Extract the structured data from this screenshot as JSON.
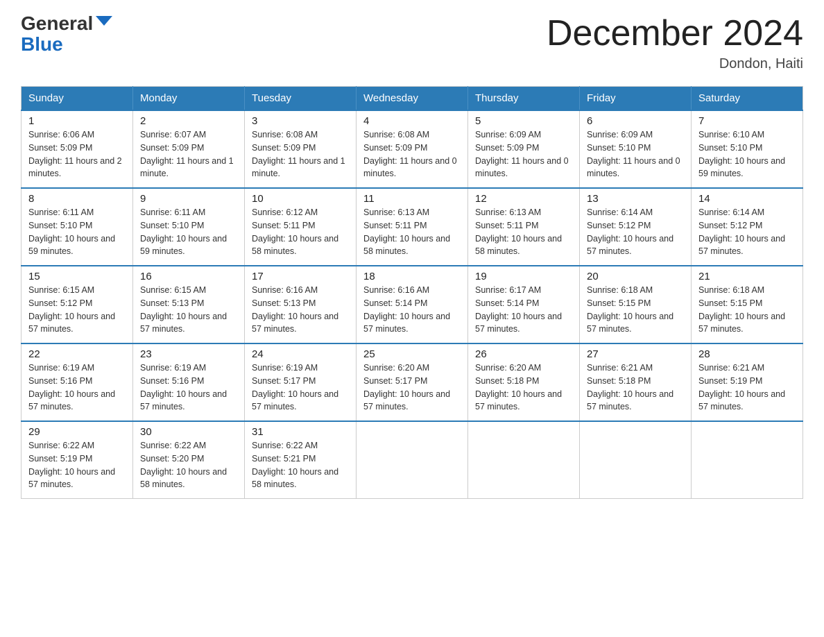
{
  "logo": {
    "general": "General",
    "blue": "Blue"
  },
  "title": {
    "month_year": "December 2024",
    "location": "Dondon, Haiti"
  },
  "days_of_week": [
    "Sunday",
    "Monday",
    "Tuesday",
    "Wednesday",
    "Thursday",
    "Friday",
    "Saturday"
  ],
  "weeks": [
    [
      {
        "day": "1",
        "sunrise": "6:06 AM",
        "sunset": "5:09 PM",
        "daylight": "11 hours and 2 minutes."
      },
      {
        "day": "2",
        "sunrise": "6:07 AM",
        "sunset": "5:09 PM",
        "daylight": "11 hours and 1 minute."
      },
      {
        "day": "3",
        "sunrise": "6:08 AM",
        "sunset": "5:09 PM",
        "daylight": "11 hours and 1 minute."
      },
      {
        "day": "4",
        "sunrise": "6:08 AM",
        "sunset": "5:09 PM",
        "daylight": "11 hours and 0 minutes."
      },
      {
        "day": "5",
        "sunrise": "6:09 AM",
        "sunset": "5:09 PM",
        "daylight": "11 hours and 0 minutes."
      },
      {
        "day": "6",
        "sunrise": "6:09 AM",
        "sunset": "5:10 PM",
        "daylight": "11 hours and 0 minutes."
      },
      {
        "day": "7",
        "sunrise": "6:10 AM",
        "sunset": "5:10 PM",
        "daylight": "10 hours and 59 minutes."
      }
    ],
    [
      {
        "day": "8",
        "sunrise": "6:11 AM",
        "sunset": "5:10 PM",
        "daylight": "10 hours and 59 minutes."
      },
      {
        "day": "9",
        "sunrise": "6:11 AM",
        "sunset": "5:10 PM",
        "daylight": "10 hours and 59 minutes."
      },
      {
        "day": "10",
        "sunrise": "6:12 AM",
        "sunset": "5:11 PM",
        "daylight": "10 hours and 58 minutes."
      },
      {
        "day": "11",
        "sunrise": "6:13 AM",
        "sunset": "5:11 PM",
        "daylight": "10 hours and 58 minutes."
      },
      {
        "day": "12",
        "sunrise": "6:13 AM",
        "sunset": "5:11 PM",
        "daylight": "10 hours and 58 minutes."
      },
      {
        "day": "13",
        "sunrise": "6:14 AM",
        "sunset": "5:12 PM",
        "daylight": "10 hours and 57 minutes."
      },
      {
        "day": "14",
        "sunrise": "6:14 AM",
        "sunset": "5:12 PM",
        "daylight": "10 hours and 57 minutes."
      }
    ],
    [
      {
        "day": "15",
        "sunrise": "6:15 AM",
        "sunset": "5:12 PM",
        "daylight": "10 hours and 57 minutes."
      },
      {
        "day": "16",
        "sunrise": "6:15 AM",
        "sunset": "5:13 PM",
        "daylight": "10 hours and 57 minutes."
      },
      {
        "day": "17",
        "sunrise": "6:16 AM",
        "sunset": "5:13 PM",
        "daylight": "10 hours and 57 minutes."
      },
      {
        "day": "18",
        "sunrise": "6:16 AM",
        "sunset": "5:14 PM",
        "daylight": "10 hours and 57 minutes."
      },
      {
        "day": "19",
        "sunrise": "6:17 AM",
        "sunset": "5:14 PM",
        "daylight": "10 hours and 57 minutes."
      },
      {
        "day": "20",
        "sunrise": "6:18 AM",
        "sunset": "5:15 PM",
        "daylight": "10 hours and 57 minutes."
      },
      {
        "day": "21",
        "sunrise": "6:18 AM",
        "sunset": "5:15 PM",
        "daylight": "10 hours and 57 minutes."
      }
    ],
    [
      {
        "day": "22",
        "sunrise": "6:19 AM",
        "sunset": "5:16 PM",
        "daylight": "10 hours and 57 minutes."
      },
      {
        "day": "23",
        "sunrise": "6:19 AM",
        "sunset": "5:16 PM",
        "daylight": "10 hours and 57 minutes."
      },
      {
        "day": "24",
        "sunrise": "6:19 AM",
        "sunset": "5:17 PM",
        "daylight": "10 hours and 57 minutes."
      },
      {
        "day": "25",
        "sunrise": "6:20 AM",
        "sunset": "5:17 PM",
        "daylight": "10 hours and 57 minutes."
      },
      {
        "day": "26",
        "sunrise": "6:20 AM",
        "sunset": "5:18 PM",
        "daylight": "10 hours and 57 minutes."
      },
      {
        "day": "27",
        "sunrise": "6:21 AM",
        "sunset": "5:18 PM",
        "daylight": "10 hours and 57 minutes."
      },
      {
        "day": "28",
        "sunrise": "6:21 AM",
        "sunset": "5:19 PM",
        "daylight": "10 hours and 57 minutes."
      }
    ],
    [
      {
        "day": "29",
        "sunrise": "6:22 AM",
        "sunset": "5:19 PM",
        "daylight": "10 hours and 57 minutes."
      },
      {
        "day": "30",
        "sunrise": "6:22 AM",
        "sunset": "5:20 PM",
        "daylight": "10 hours and 58 minutes."
      },
      {
        "day": "31",
        "sunrise": "6:22 AM",
        "sunset": "5:21 PM",
        "daylight": "10 hours and 58 minutes."
      },
      null,
      null,
      null,
      null
    ]
  ]
}
